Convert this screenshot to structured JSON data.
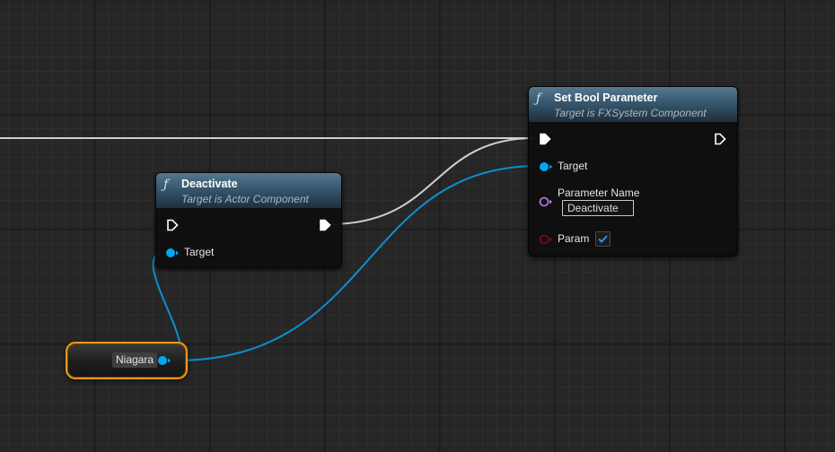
{
  "graph": {
    "nodes": {
      "deactivate": {
        "title": "Deactivate",
        "subtitle": "Target is Actor Component",
        "pins": {
          "target": "Target"
        }
      },
      "set_bool_parameter": {
        "title": "Set Bool Parameter",
        "subtitle": "Target is FXSystem Component",
        "pins": {
          "target": "Target",
          "parameter_name": "Parameter Name",
          "parameter_name_value": "Deactivate",
          "param": "Param",
          "param_checked": true
        }
      },
      "variable": {
        "label": "Niagara",
        "selected": true
      }
    },
    "icons": {
      "function": "ƒ",
      "function_icon": "function-icon",
      "exec_icon": "exec-pin-icon",
      "object_pin_icon": "object-pin-icon",
      "name_pin_icon": "name-pin-icon",
      "bool_pin_icon": "bool-pin-icon",
      "checkmark_icon": "checkmark-icon"
    },
    "colors": {
      "exec_wire": "#cfcfcf",
      "object_pin": "#00a8f2",
      "object_wire": "#0b8fd0",
      "name_pin": "#c87ff0",
      "bool_pin": "#8a0c0c",
      "selection": "#f09a12",
      "node_header": "#3b5c73"
    }
  }
}
